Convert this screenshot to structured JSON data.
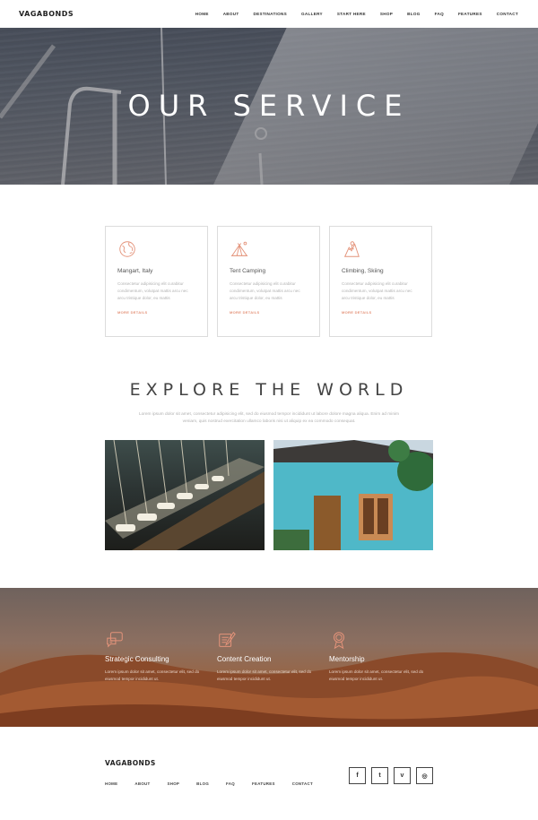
{
  "header": {
    "logo": "VAGABONDS",
    "nav": [
      "HOME",
      "ABOUT",
      "DESTINATIONS",
      "GALLERY",
      "START HERE",
      "SHOP",
      "BLOG",
      "FAQ",
      "FEATURES",
      "CONTACT"
    ]
  },
  "hero": {
    "title": "OUR SERVICE"
  },
  "services": [
    {
      "icon": "globe-icon",
      "title": "Mangart, Italy",
      "text": "Consectetur adipisicing elit curabitur condimentum, volutpat mattis arcu nec arcu tristique dolor, eu mattis",
      "more": "MORE DETAILS"
    },
    {
      "icon": "tent-icon",
      "title": "Tent Camping",
      "text": "Consectetur adipisicing elit curabitur condimentum, volutpat mattis arcu nec arcu tristique dolor, eu mattis",
      "more": "MORE DETAILS"
    },
    {
      "icon": "climbing-icon",
      "title": "Climbing, Skiing",
      "text": "Consectetur adipisicing elit curabitur condimentum, volutpat mattis arcu nec arcu tristique dolor, eu mattis",
      "more": "MORE DETAILS"
    }
  ],
  "explore": {
    "title": "EXPLORE THE WORLD",
    "text": "Lorem ipsum dolor sit amet, consectetur adipisicing elit, sed do eiusmod tempor incididunt ut labore dolore magna aliqua. Enim ad minim veniam, quis nostrud exercitation ullamco laboris nisi ut aliquip ex ea commodo consequat."
  },
  "features": [
    {
      "icon": "chat-icon",
      "title": "Strategic Consulting",
      "text": "Lorem ipsum dolor sit amet, consectetur elit, sed do eiusmod tempor incididunt ut."
    },
    {
      "icon": "pen-icon",
      "title": "Content Creation",
      "text": "Lorem ipsum dolor sit amet, consectetur elit, sed do eiusmod tempor incididunt ut."
    },
    {
      "icon": "medal-icon",
      "title": "Mentorship",
      "text": "Lorem ipsum dolor sit amet, consectetur elit, sed do eiusmod tempor incididunt ut."
    }
  ],
  "footer": {
    "logo": "VAGABONDS",
    "nav": [
      "HOME",
      "ABOUT",
      "SHOP",
      "BLOG",
      "FAQ",
      "FEATURES",
      "CONTACT"
    ],
    "socials": [
      {
        "icon": "facebook-icon",
        "glyph": "f"
      },
      {
        "icon": "twitter-icon",
        "glyph": "t"
      },
      {
        "icon": "vimeo-icon",
        "glyph": "v"
      },
      {
        "icon": "instagram-icon",
        "glyph": "◎"
      }
    ]
  },
  "colors": {
    "accent": "#e4937a",
    "text": "#333333",
    "muted": "#b0b0b0"
  }
}
